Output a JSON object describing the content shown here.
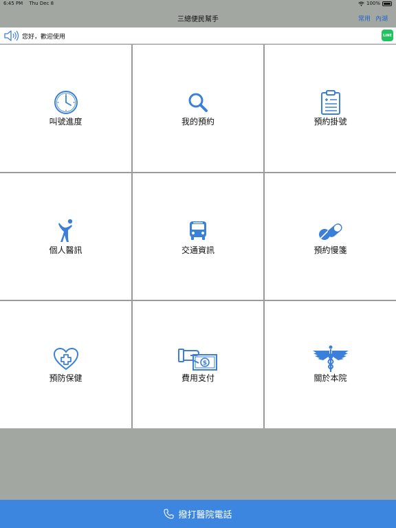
{
  "status_bar": {
    "time": "6:45 PM",
    "date": "Thu Dec 8",
    "battery_text": "100%",
    "battery_level": 1.0
  },
  "nav": {
    "title": "三總便民幫手",
    "right_items": [
      "常用",
      "內湖"
    ]
  },
  "greeting": {
    "text": "您好，歡迎使用",
    "line_label": "LINE"
  },
  "menu": {
    "items": [
      {
        "label": "叫號進度",
        "icon": "clock-icon"
      },
      {
        "label": "我的預約",
        "icon": "magnifier-icon"
      },
      {
        "label": "預約掛號",
        "icon": "clipboard-icon"
      },
      {
        "label": "個人醫訊",
        "icon": "person-icon"
      },
      {
        "label": "交通資訊",
        "icon": "bus-icon"
      },
      {
        "label": "預約慢箋",
        "icon": "pill-capsule-icon"
      },
      {
        "label": "預防保健",
        "icon": "heart-cross-icon"
      },
      {
        "label": "費用支付",
        "icon": "money-hand-icon"
      },
      {
        "label": "關於本院",
        "icon": "caduceus-icon"
      }
    ]
  },
  "footer": {
    "label": "撥打醫院電話",
    "icon": "phone-icon"
  },
  "colors": {
    "accent": "#3d86e0",
    "icon_blue": "#3b7fd9",
    "background_gray": "#a2a8a1",
    "line_green": "#22c35e"
  }
}
